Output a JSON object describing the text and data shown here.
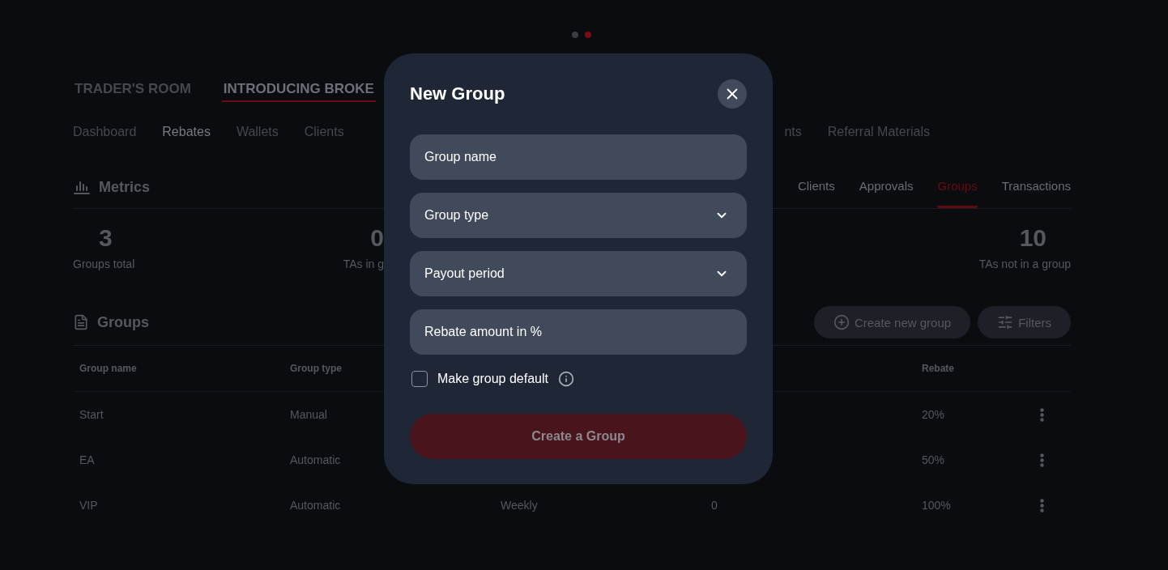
{
  "pager_dots": [
    {
      "selected": false
    },
    {
      "selected": true
    }
  ],
  "top_tabs": [
    {
      "label": "TRADER'S ROOM",
      "selected": false
    },
    {
      "label": "INTRODUCING BROKE",
      "selected": true
    }
  ],
  "nav_left": [
    {
      "label": "Dashboard",
      "selected": false
    },
    {
      "label": "Rebates",
      "selected": true
    },
    {
      "label": "Wallets",
      "selected": false
    },
    {
      "label": "Clients",
      "selected": false
    }
  ],
  "nav_right": [
    {
      "label": "nts",
      "selected": false
    },
    {
      "label": "Referral Materials",
      "selected": false
    }
  ],
  "metrics": {
    "title": "Metrics",
    "tabs": [
      {
        "label": "Clients",
        "selected": false
      },
      {
        "label": "Approvals",
        "selected": false
      },
      {
        "label": "Groups",
        "selected": true
      },
      {
        "label": "Transactions",
        "selected": false
      }
    ],
    "stats_left": [
      {
        "value": "3",
        "label": "Groups total"
      },
      {
        "value": "0",
        "label": "TAs in g"
      }
    ],
    "stats_right": [
      {
        "value": "10",
        "label": "TAs not in a group"
      }
    ]
  },
  "groups": {
    "title": "Groups",
    "create_button": "Create new group",
    "filters_button": "Filters",
    "header": {
      "group_name": "Group name",
      "group_type": "Group type",
      "rebate": "Rebate"
    },
    "rows": [
      {
        "group_name": "Start",
        "group_type": "Manual",
        "rebate": "20%"
      },
      {
        "group_name": "EA",
        "group_type": "Automatic",
        "rebate": "50%"
      },
      {
        "group_name": "VIP",
        "group_type": "Automatic",
        "column_3": "Weekly",
        "column_4": "0",
        "rebate": "100%"
      }
    ]
  },
  "modal": {
    "title": "New Group",
    "fields": [
      {
        "kind": "input",
        "placeholder": "Group name"
      },
      {
        "kind": "select",
        "placeholder": "Group type"
      },
      {
        "kind": "select",
        "placeholder": "Payout period"
      },
      {
        "kind": "input",
        "placeholder": "Rebate amount in %"
      }
    ],
    "make_default": {
      "label": "Make group default",
      "checked": false
    },
    "submit": {
      "label": "Create a Group",
      "disabled": true
    }
  }
}
